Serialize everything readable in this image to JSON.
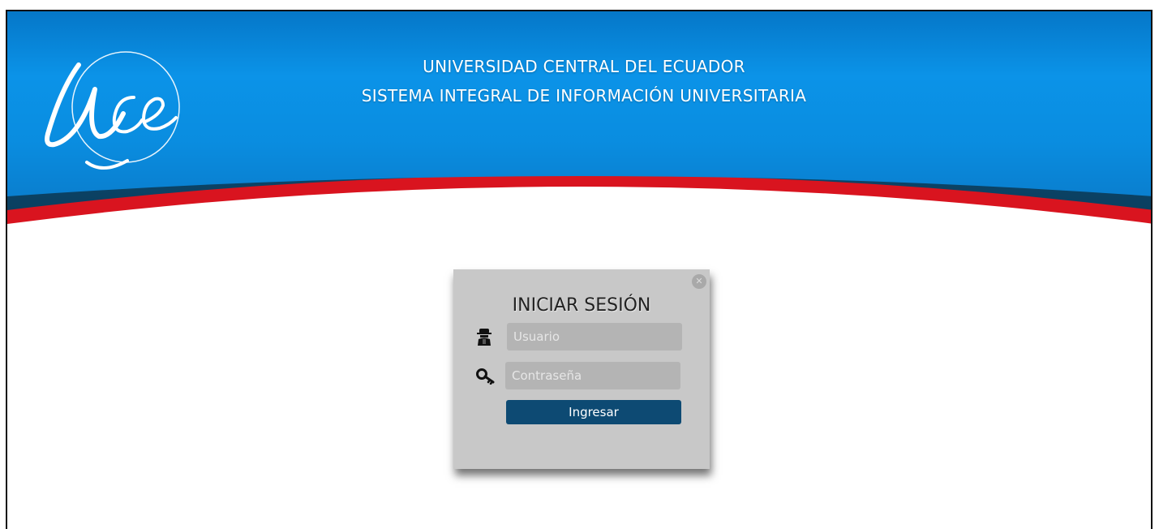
{
  "header": {
    "logo_text": "Uce",
    "line1": "UNIVERSIDAD CENTRAL DEL ECUADOR",
    "line2": "SISTEMA INTEGRAL DE INFORMACIÓN UNIVERSITARIA"
  },
  "login": {
    "title": "INICIAR SESIÓN",
    "close_icon": "close-icon",
    "username": {
      "icon": "spy-user-icon",
      "placeholder": "Usuario",
      "value": ""
    },
    "password": {
      "icon": "key-icon",
      "placeholder": "Contraseña",
      "value": ""
    },
    "submit_label": "Ingresar"
  },
  "colors": {
    "header_blue": "#0a8ee3",
    "header_dark": "#0f4a6e",
    "stripe_red": "#d9141f",
    "login_bg": "#c8c8c8",
    "input_bg": "#b4b4b4",
    "button_bg": "#0d4a73"
  }
}
